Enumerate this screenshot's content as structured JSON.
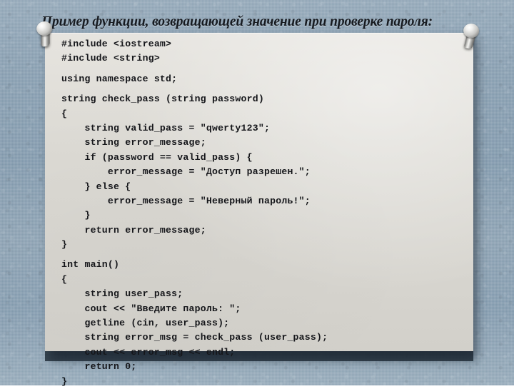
{
  "slide": {
    "title": "Пример функции, возвращающей значение при проверке пароля:",
    "background_color": "#8fa3b4",
    "card_color": "#dddbd5",
    "text_color": "#15161a"
  },
  "code_card": {
    "language": "cpp",
    "lines": [
      {
        "text": "#include <iostream>",
        "gap": false
      },
      {
        "text": "#include <string>",
        "gap": false
      },
      {
        "text": "using namespace std;",
        "gap": true
      },
      {
        "text": "string check_pass (string password)",
        "gap": true
      },
      {
        "text": "{",
        "gap": false
      },
      {
        "text": "    string valid_pass = \"qwerty123\";",
        "gap": false
      },
      {
        "text": "    string error_message;",
        "gap": false
      },
      {
        "text": "    if (password == valid_pass) {",
        "gap": false
      },
      {
        "text": "        error_message = \"Доступ разрешен.\";",
        "gap": false
      },
      {
        "text": "    } else {",
        "gap": false
      },
      {
        "text": "        error_message = \"Неверный пароль!\";",
        "gap": false
      },
      {
        "text": "    }",
        "gap": false
      },
      {
        "text": "    return error_message;",
        "gap": false
      },
      {
        "text": "}",
        "gap": false
      },
      {
        "text": "int main()",
        "gap": true
      },
      {
        "text": "{",
        "gap": false
      },
      {
        "text": "    string user_pass;",
        "gap": false
      },
      {
        "text": "    cout << \"Введите пароль: \";",
        "gap": false
      },
      {
        "text": "    getline (cin, user_pass);",
        "gap": false
      },
      {
        "text": "    string error_msg = check_pass (user_pass);",
        "gap": false
      },
      {
        "text": "    cout << error_msg << endl;",
        "gap": false
      },
      {
        "text": "    return 0;",
        "gap": false
      },
      {
        "text": "}",
        "gap": false
      }
    ]
  },
  "decorations": {
    "pin_left": "push-pin",
    "pin_right": "push-pin"
  }
}
